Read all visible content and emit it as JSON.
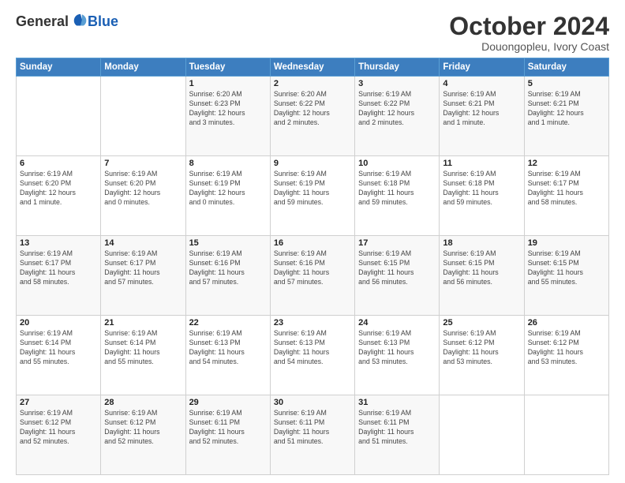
{
  "logo": {
    "general": "General",
    "blue": "Blue"
  },
  "header": {
    "month": "October 2024",
    "location": "Douongopleu, Ivory Coast"
  },
  "weekdays": [
    "Sunday",
    "Monday",
    "Tuesday",
    "Wednesday",
    "Thursday",
    "Friday",
    "Saturday"
  ],
  "weeks": [
    [
      {
        "day": "",
        "info": ""
      },
      {
        "day": "",
        "info": ""
      },
      {
        "day": "1",
        "info": "Sunrise: 6:20 AM\nSunset: 6:23 PM\nDaylight: 12 hours\nand 3 minutes."
      },
      {
        "day": "2",
        "info": "Sunrise: 6:20 AM\nSunset: 6:22 PM\nDaylight: 12 hours\nand 2 minutes."
      },
      {
        "day": "3",
        "info": "Sunrise: 6:19 AM\nSunset: 6:22 PM\nDaylight: 12 hours\nand 2 minutes."
      },
      {
        "day": "4",
        "info": "Sunrise: 6:19 AM\nSunset: 6:21 PM\nDaylight: 12 hours\nand 1 minute."
      },
      {
        "day": "5",
        "info": "Sunrise: 6:19 AM\nSunset: 6:21 PM\nDaylight: 12 hours\nand 1 minute."
      }
    ],
    [
      {
        "day": "6",
        "info": "Sunrise: 6:19 AM\nSunset: 6:20 PM\nDaylight: 12 hours\nand 1 minute."
      },
      {
        "day": "7",
        "info": "Sunrise: 6:19 AM\nSunset: 6:20 PM\nDaylight: 12 hours\nand 0 minutes."
      },
      {
        "day": "8",
        "info": "Sunrise: 6:19 AM\nSunset: 6:19 PM\nDaylight: 12 hours\nand 0 minutes."
      },
      {
        "day": "9",
        "info": "Sunrise: 6:19 AM\nSunset: 6:19 PM\nDaylight: 11 hours\nand 59 minutes."
      },
      {
        "day": "10",
        "info": "Sunrise: 6:19 AM\nSunset: 6:18 PM\nDaylight: 11 hours\nand 59 minutes."
      },
      {
        "day": "11",
        "info": "Sunrise: 6:19 AM\nSunset: 6:18 PM\nDaylight: 11 hours\nand 59 minutes."
      },
      {
        "day": "12",
        "info": "Sunrise: 6:19 AM\nSunset: 6:17 PM\nDaylight: 11 hours\nand 58 minutes."
      }
    ],
    [
      {
        "day": "13",
        "info": "Sunrise: 6:19 AM\nSunset: 6:17 PM\nDaylight: 11 hours\nand 58 minutes."
      },
      {
        "day": "14",
        "info": "Sunrise: 6:19 AM\nSunset: 6:17 PM\nDaylight: 11 hours\nand 57 minutes."
      },
      {
        "day": "15",
        "info": "Sunrise: 6:19 AM\nSunset: 6:16 PM\nDaylight: 11 hours\nand 57 minutes."
      },
      {
        "day": "16",
        "info": "Sunrise: 6:19 AM\nSunset: 6:16 PM\nDaylight: 11 hours\nand 57 minutes."
      },
      {
        "day": "17",
        "info": "Sunrise: 6:19 AM\nSunset: 6:15 PM\nDaylight: 11 hours\nand 56 minutes."
      },
      {
        "day": "18",
        "info": "Sunrise: 6:19 AM\nSunset: 6:15 PM\nDaylight: 11 hours\nand 56 minutes."
      },
      {
        "day": "19",
        "info": "Sunrise: 6:19 AM\nSunset: 6:15 PM\nDaylight: 11 hours\nand 55 minutes."
      }
    ],
    [
      {
        "day": "20",
        "info": "Sunrise: 6:19 AM\nSunset: 6:14 PM\nDaylight: 11 hours\nand 55 minutes."
      },
      {
        "day": "21",
        "info": "Sunrise: 6:19 AM\nSunset: 6:14 PM\nDaylight: 11 hours\nand 55 minutes."
      },
      {
        "day": "22",
        "info": "Sunrise: 6:19 AM\nSunset: 6:13 PM\nDaylight: 11 hours\nand 54 minutes."
      },
      {
        "day": "23",
        "info": "Sunrise: 6:19 AM\nSunset: 6:13 PM\nDaylight: 11 hours\nand 54 minutes."
      },
      {
        "day": "24",
        "info": "Sunrise: 6:19 AM\nSunset: 6:13 PM\nDaylight: 11 hours\nand 53 minutes."
      },
      {
        "day": "25",
        "info": "Sunrise: 6:19 AM\nSunset: 6:12 PM\nDaylight: 11 hours\nand 53 minutes."
      },
      {
        "day": "26",
        "info": "Sunrise: 6:19 AM\nSunset: 6:12 PM\nDaylight: 11 hours\nand 53 minutes."
      }
    ],
    [
      {
        "day": "27",
        "info": "Sunrise: 6:19 AM\nSunset: 6:12 PM\nDaylight: 11 hours\nand 52 minutes."
      },
      {
        "day": "28",
        "info": "Sunrise: 6:19 AM\nSunset: 6:12 PM\nDaylight: 11 hours\nand 52 minutes."
      },
      {
        "day": "29",
        "info": "Sunrise: 6:19 AM\nSunset: 6:11 PM\nDaylight: 11 hours\nand 52 minutes."
      },
      {
        "day": "30",
        "info": "Sunrise: 6:19 AM\nSunset: 6:11 PM\nDaylight: 11 hours\nand 51 minutes."
      },
      {
        "day": "31",
        "info": "Sunrise: 6:19 AM\nSunset: 6:11 PM\nDaylight: 11 hours\nand 51 minutes."
      },
      {
        "day": "",
        "info": ""
      },
      {
        "day": "",
        "info": ""
      }
    ]
  ]
}
